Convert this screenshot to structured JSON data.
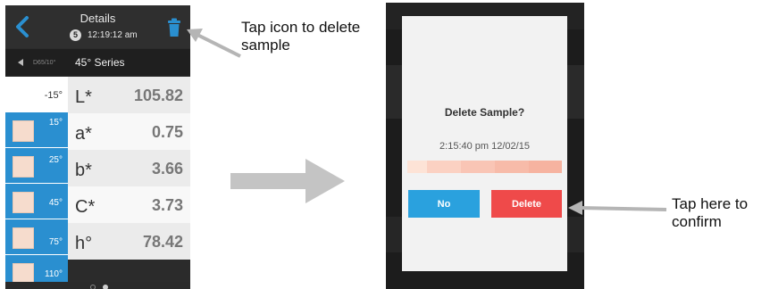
{
  "left_phone": {
    "header": {
      "title": "Details",
      "sample_number": "5",
      "time": "12:19:12 am"
    },
    "series_bar": {
      "prev_label": "D65/10°",
      "title": "45° Series"
    },
    "angles": [
      "-15°",
      "15°",
      "25°",
      "45°",
      "75°",
      "110°"
    ],
    "values": [
      {
        "key": "L*",
        "value": "105.82"
      },
      {
        "key": "a*",
        "value": "0.75"
      },
      {
        "key": "b*",
        "value": "3.66"
      },
      {
        "key": "C*",
        "value": "3.73"
      },
      {
        "key": "h°",
        "value": "78.42"
      }
    ]
  },
  "annotations": {
    "trash": "Tap icon to delete sample",
    "confirm": "Tap here to confirm"
  },
  "dialog": {
    "title": "Delete Sample?",
    "timestamp": "2:15:40 pm 12/02/15",
    "no_label": "No",
    "delete_label": "Delete",
    "strip_colors": [
      "#fde3d6",
      "#fbd1c2",
      "#f9c5b5",
      "#f7bba9",
      "#f6b3a0"
    ]
  },
  "colors": {
    "accent_blue": "#2a8fd0",
    "no_button": "#2aa1de",
    "delete_button": "#ef4a4a"
  }
}
